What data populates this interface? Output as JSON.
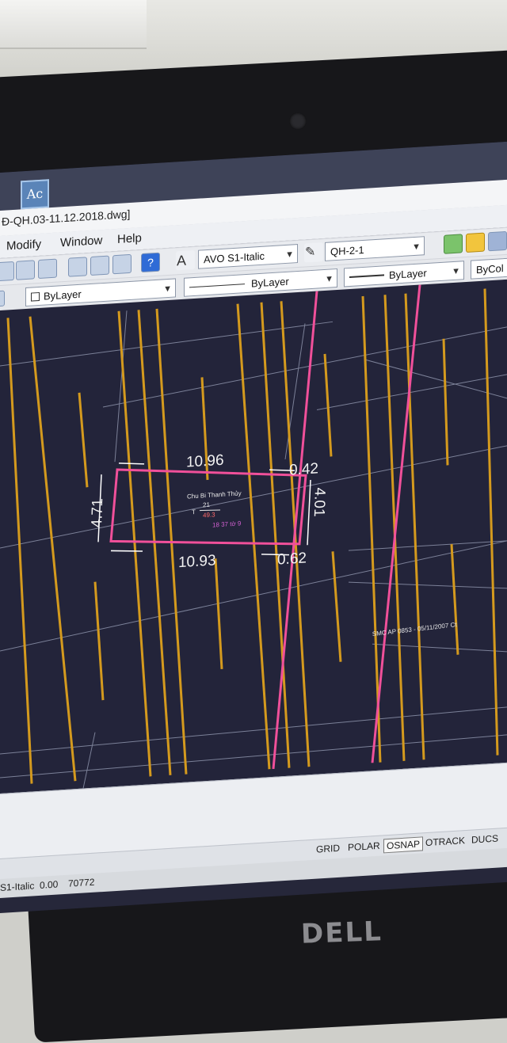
{
  "window": {
    "title": "Đ-QH.03-11.12.2018.dwg]"
  },
  "menu": [
    "Modify",
    "Window",
    "Help"
  ],
  "toolbar": {
    "text_style": "AVO S1-Italic",
    "layer": "QH-2-1"
  },
  "properties": {
    "color": "ByLayer",
    "linetype": "ByLayer",
    "lineweight": "ByLayer",
    "plotstyle": "ByCol"
  },
  "drawing": {
    "dim_top": "10.96",
    "dim_bottom": "10.93",
    "dim_left": "4.71",
    "dim_right": "4.01",
    "dim_top_right": "0.42",
    "dim_bottom_right": "0.62",
    "owner_label": "Chu Bi Thanh Thủy",
    "parcel_number": "21",
    "land_type_prefix": "T",
    "area": "49.3",
    "sheet_note": "18 37 tờ 9",
    "side_note": "SMC AP 0853 - 05/11/2007 Ct"
  },
  "status": {
    "buttons": [
      "GRID",
      "POLAR",
      "OSNAP",
      "OTRACK",
      "DUCS"
    ],
    "active_button": "OSNAP",
    "style": "S1-Italic",
    "value1": "0.00",
    "value2": "70772"
  },
  "brand": "DELL",
  "app_icon_text": "Ac"
}
